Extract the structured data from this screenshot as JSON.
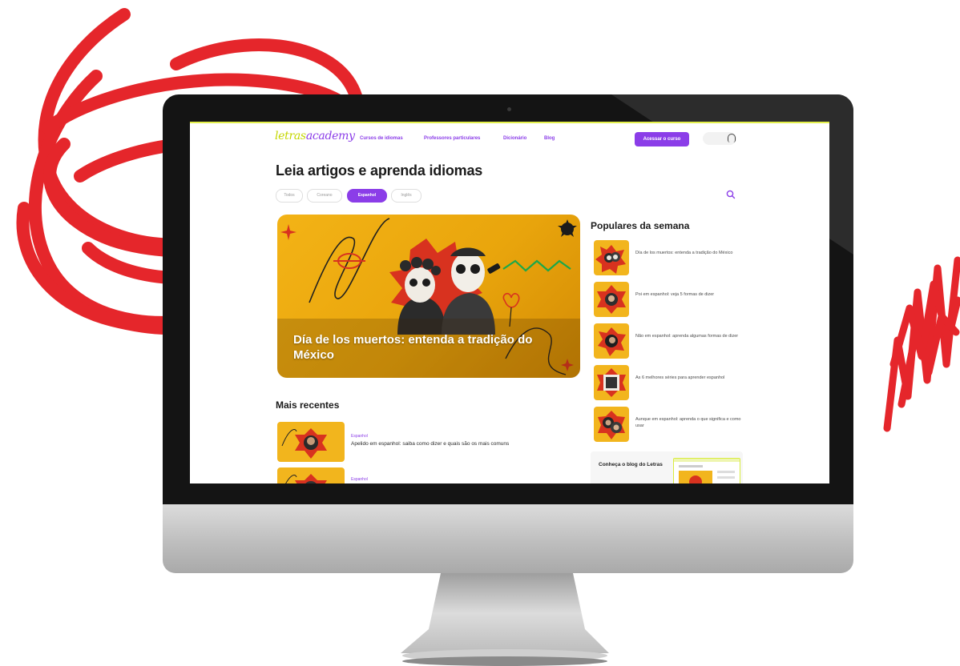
{
  "nav": {
    "logo_part1": "letras",
    "logo_part2": "academy",
    "links": [
      "Cursos de idiomas",
      "Professores particulares",
      "Dicionário",
      "Blog"
    ],
    "cta": "Acessar o curso"
  },
  "page": {
    "title": "Leia artigos e aprenda idiomas"
  },
  "filters": [
    "Todos",
    "Coreano",
    "Espanhol",
    "Inglês"
  ],
  "active_filter": "Espanhol",
  "hero": {
    "title": "Día de los muertos: entenda a tradição do México"
  },
  "recent": {
    "heading": "Mais recentes",
    "items": [
      {
        "tag": "Espanhol",
        "title": "Apelido em espanhol: saiba como dizer e quais são os mais comuns"
      },
      {
        "tag": "Espanhol",
        "title": ""
      }
    ]
  },
  "popular": {
    "heading": "Populares da semana",
    "items": [
      {
        "title": "Día de los muertos: entenda a tradição do México"
      },
      {
        "title": "Poi em espanhol: veja 5 formas de dizer"
      },
      {
        "title": "Não em espanhol: aprenda algumas formas de dizer"
      },
      {
        "title": "As 6 melhores séries para aprender espanhol"
      },
      {
        "title": "Aunque em espanhol: aprenda o que significa e como usar"
      }
    ]
  },
  "blog_promo": {
    "text": "Conheça o blog do Letras"
  },
  "colors": {
    "brand_purple": "#8b3de8",
    "brand_lime": "#c5d700",
    "hero_orange": "#f3b316",
    "scribble_red": "#e5262b"
  }
}
